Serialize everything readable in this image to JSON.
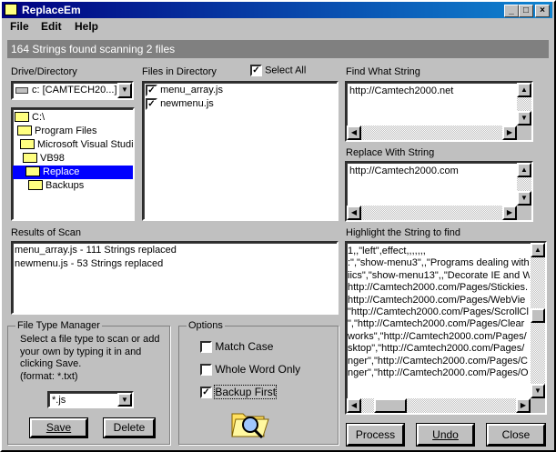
{
  "window": {
    "title": "ReplaceEm",
    "buttons": {
      "minimize": "_",
      "maximize": "□",
      "close": "×"
    }
  },
  "menu": [
    "File",
    "Edit",
    "Help"
  ],
  "status": "164 Strings found scanning 2 files",
  "drive": {
    "label": "Drive/Directory",
    "value": "c: [CAMTECH20...]"
  },
  "tree": [
    {
      "label": "C:\\",
      "selected": false
    },
    {
      "label": "Program Files",
      "selected": false
    },
    {
      "label": "Microsoft Visual Studio",
      "selected": false
    },
    {
      "label": "VB98",
      "selected": false
    },
    {
      "label": "Replace",
      "selected": true
    },
    {
      "label": "Backups",
      "selected": false
    }
  ],
  "files": {
    "label": "Files in Directory",
    "select_all": "Select All",
    "select_all_checked": true,
    "items": [
      {
        "label": "menu_array.js",
        "checked": true
      },
      {
        "label": "newmenu.js",
        "checked": true
      }
    ]
  },
  "find": {
    "label": "Find What String",
    "value": "http://Camtech2000.net"
  },
  "replace": {
    "label": "Replace With String",
    "value": "http://Camtech2000.com"
  },
  "results": {
    "label": "Results of Scan",
    "lines": [
      "menu_array.js - 111 Strings replaced",
      "newmenu.js - 53 Strings replaced"
    ]
  },
  "highlight": {
    "label": "Highlight the String to find",
    "lines": [
      "1,,\"left\",effect,,,,,,,",
      ":\",\"show-menu3\",,\"Programs dealing with I",
      "iics\",\"show-menu13\",,\"Decorate IE and W",
      " http://Camtech2000.com/Pages/Stickies.",
      " http://Camtech2000.com/Pages/WebVie",
      "\"http://Camtech2000.com/Pages/ScrollCl",
      " \",\"http://Camtech2000.com/Pages/Clear",
      "works\",\"http://Camtech2000.com/Pages/",
      "sktop\",\"http://Camtech2000.com/Pages/",
      "nger\",\"http://Camtech2000.com/Pages/C",
      "nger\",\"http://Camtech2000.com/Pages/O"
    ]
  },
  "file_type": {
    "title": "File Type Manager",
    "description": [
      "Select a file type to scan or add",
      "your own by typing it in and",
      "clicking Save.",
      "(format: *.txt)"
    ],
    "value": "*.js",
    "save": "Save",
    "delete": "Delete"
  },
  "options": {
    "title": "Options",
    "items": [
      {
        "label": "Match Case",
        "checked": false
      },
      {
        "label": "Whole Word Only",
        "checked": false
      },
      {
        "label": "Backup First",
        "checked": true
      }
    ]
  },
  "actions": {
    "process": "Process",
    "undo": "Undo",
    "close": "Close"
  }
}
